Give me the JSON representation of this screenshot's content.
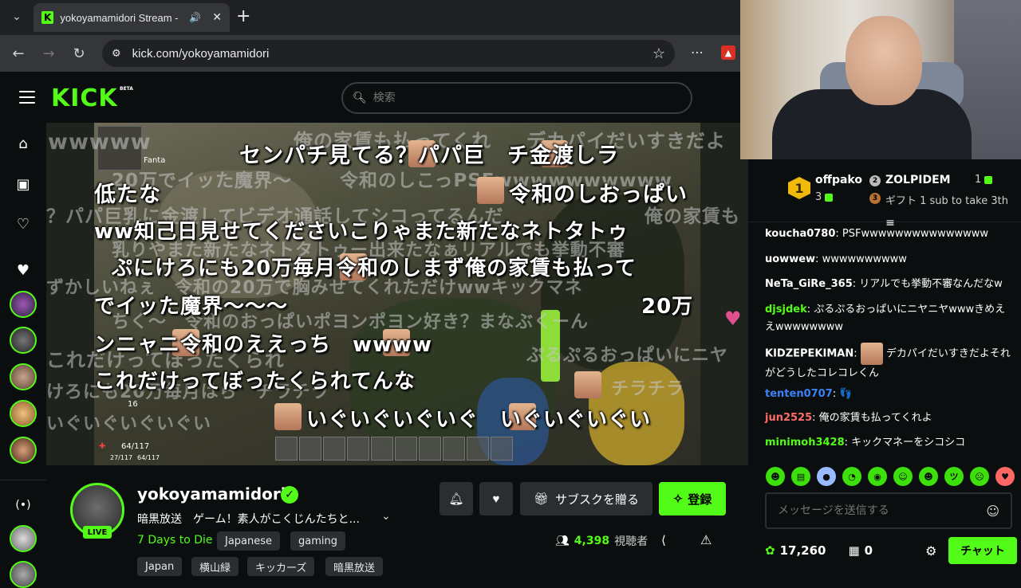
{
  "browser": {
    "tab_title": "yokoyamamidori Stream - ",
    "url": "kick.com/yokoyamamidori",
    "icons": [
      "tab-menu-chevron",
      "audio-icon",
      "close-icon",
      "new-tab-plus",
      "back-arrow",
      "forward-arrow",
      "reload-icon",
      "site-info-icon",
      "bookmark-star",
      "extensions-icon",
      "pdf-icon"
    ]
  },
  "header": {
    "logo": "KICK",
    "beta": "BETA",
    "search_placeholder": "検索"
  },
  "video": {
    "hud_name": "Fanta",
    "hud_health": "64/117",
    "hud_stamina": "27/117",
    "hud_stamina2": "64/117",
    "hud_count": "16",
    "comments_main": [
      "センパチ見てる？パパ巨　チ金渡しラ",
      "低たな",
      "令和のしおっぱい",
      "ww知己日見せてくださいこりゃまた新たなネトタトゥ",
      "ぷにけろにも20万毎月令和のしまず俺の家賃も払って",
      "でイッた魔界〜〜〜",
      "20万",
      "ンニャニ令和のええっち　wwww",
      "これだけってぼったくられてんな",
      "いぐいぐいぐいぐ　いぐいぐいぐい"
    ],
    "comments_faint": [
      "wwwww",
      "俺の家賃も払ってくれ",
      "デカパイだいすきだよ",
      "20万でイッた魔界〜",
      "令和のしこっPSFwwwwwwwwww",
      "？パパ巨乳に金渡してビデオ通話してシコってるんだ",
      "俺の家賃も",
      "乳りやまた新たなネトタトゥー出来たなぁリアルでも挙動不審",
      "ずかしいねぇ　令和の20万で胸みせてくれただけwwキックマネ",
      "ちく〜　令和のおっぱいポヨンポヨン好き？まなぶくーん",
      "これだけってぼったくられ",
      "ぷるぷるおっぱいにニヤ",
      "けろにも20万毎月はら　チラチラ",
      "チラチラ",
      "いぐいぐいぐいぐい"
    ]
  },
  "chat": {
    "leaderboard": [
      {
        "rank": "1",
        "name": "offpako",
        "count": "3"
      },
      {
        "rank": "2",
        "name": "ZOLPIDEM",
        "count": "1"
      },
      {
        "rank": "3",
        "note": "ギフト 1 sub to take 3th"
      }
    ],
    "messages": [
      {
        "user": "koucha0780",
        "color": "#ffffff",
        "text": "PSFwwwwwwwwwwwwwww"
      },
      {
        "user": "uowwew",
        "color": "#ffffff",
        "text": "wwwwwwwwww"
      },
      {
        "user": "NeTa_GiRe_365",
        "color": "#ffffff",
        "text": "リアルでも挙動不審なんだなw"
      },
      {
        "user": "djsjdek",
        "color": "#53fc18",
        "text": "ぷるぷるおっぱいにニヤニヤwwwきめええwwwwwwww"
      },
      {
        "user": "KIDZEPEKIMAN",
        "color": "#ffffff",
        "text": "デカパイだいすきだよそれがどうしたコレコレくん"
      },
      {
        "user": "tenten0707",
        "color": "#3b82f6",
        "text": ""
      },
      {
        "user": "jun2525",
        "color": "#ff6b6b",
        "text": "俺の家賃も払ってくれよ"
      },
      {
        "user": "minimoh3428",
        "color": "#53fc18",
        "text": "キックマネーをシコシコ"
      }
    ],
    "input_placeholder": "メッセージを送信する",
    "points": "17,260",
    "items": "0",
    "send_label": "チャット"
  },
  "stream": {
    "streamer": "yokoyamamidori",
    "live": "LIVE",
    "title": "暗黒放送　ゲーム！素人がこくじんたちと...",
    "category": "7 Days to Die",
    "tags": [
      "Japanese",
      "gaming",
      "Japan",
      "横山緑",
      "キッカーズ",
      "暗黒放送"
    ],
    "gift_sub_label": "サブスクを贈る",
    "follow_label": "登録",
    "viewers": "4,398",
    "viewers_label": "視聴者"
  },
  "colors": {
    "accent": "#53fc18",
    "bg": "#0b0e0f",
    "chrome": "#35363a"
  }
}
